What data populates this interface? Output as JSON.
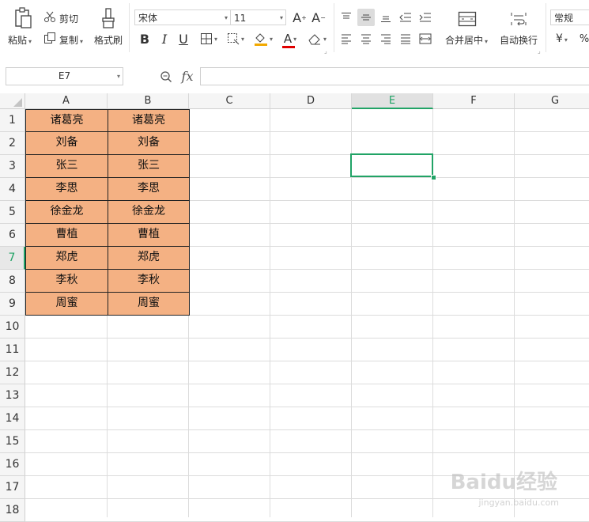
{
  "toolbar": {
    "paste": "粘贴",
    "cut": "剪切",
    "copy": "复制",
    "format_painter": "格式刷",
    "font_name": "宋体",
    "font_size": "11",
    "bold": "B",
    "italic": "I",
    "underline": "U",
    "font_color_letter": "A",
    "merge_center": "合并居中",
    "wrap_text": "自动换行",
    "number_format": "常规",
    "currency": "¥"
  },
  "formula_bar": {
    "name_box": "E7",
    "fx": "fx",
    "content": ""
  },
  "columns": [
    "A",
    "B",
    "C",
    "D",
    "E",
    "F",
    "G"
  ],
  "active_column": "E",
  "rows": [
    "1",
    "2",
    "3",
    "4",
    "5",
    "6",
    "7",
    "8",
    "9",
    "10",
    "11",
    "12",
    "13",
    "14",
    "15",
    "16",
    "17",
    "18"
  ],
  "active_row": "7",
  "cells": {
    "colA": [
      "诸葛亮",
      "刘备",
      "张三",
      "李思",
      "徐金龙",
      "曹植",
      "郑虎",
      "李秋",
      "周蜜"
    ],
    "colB": [
      "诸葛亮",
      "刘备",
      "张三",
      "李思",
      "徐金龙",
      "曹植",
      "郑虎",
      "李秋",
      "周蜜"
    ]
  },
  "colors": {
    "fill": "#f4b183",
    "accent": "#21a366",
    "font_color_bar": "#e00000",
    "fill_color_bar": "#f2a900"
  },
  "watermark": {
    "brand": "Baidu经验",
    "url": "jingyan.baidu.com"
  }
}
